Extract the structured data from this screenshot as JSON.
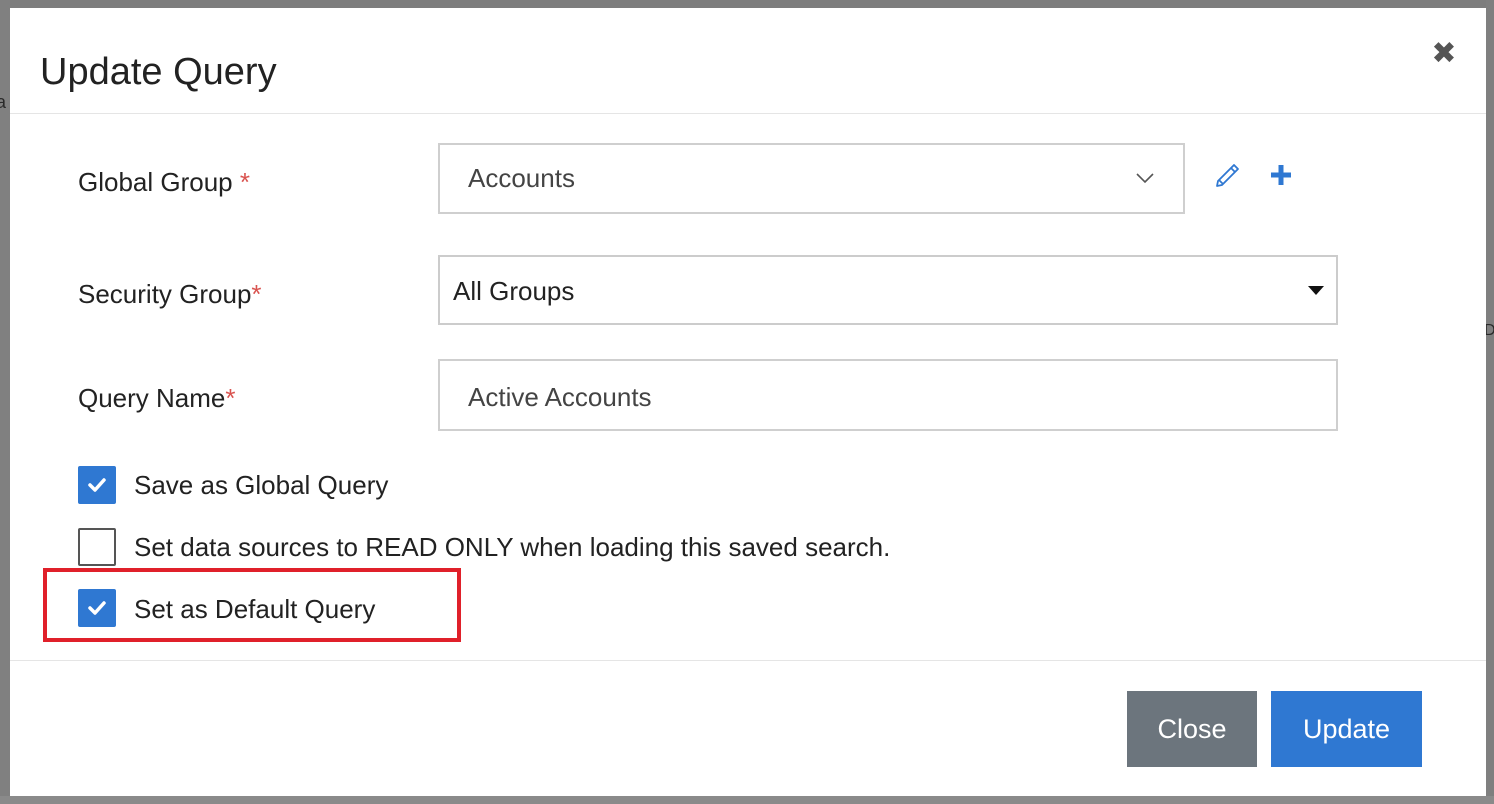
{
  "dialog": {
    "title": "Update Query",
    "close_icon": "close-icon"
  },
  "form": {
    "global_group": {
      "label": "Global Group",
      "required_mark": "*",
      "value": "Accounts",
      "edit_icon": "pencil-icon",
      "add_icon": "plus-icon"
    },
    "security_group": {
      "label": "Security Group",
      "required_mark": "*",
      "value": "All Groups"
    },
    "query_name": {
      "label": "Query Name",
      "required_mark": "*",
      "value": "Active Accounts"
    },
    "checkboxes": [
      {
        "label": "Save as Global Query",
        "checked": true
      },
      {
        "label": "Set data sources to READ ONLY when loading this saved search.",
        "checked": false
      },
      {
        "label": "Set as Default Query",
        "checked": true
      }
    ]
  },
  "footer": {
    "close_label": "Close",
    "update_label": "Update"
  },
  "background": {
    "left_fragment": "a",
    "right_fragment": "D"
  },
  "colors": {
    "primary": "#2f78d2",
    "secondary": "#6c757d",
    "required": "#d9534f",
    "highlight": "#e0202a"
  }
}
